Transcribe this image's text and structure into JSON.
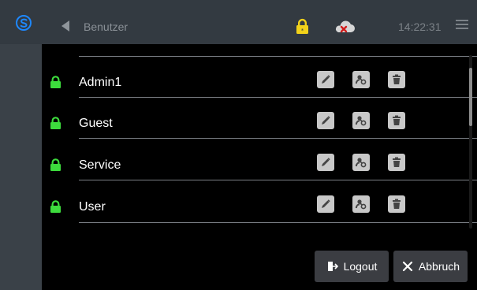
{
  "header": {
    "title": "Benutzer",
    "time": "14:22:31"
  },
  "users": [
    {
      "name": "Admin1"
    },
    {
      "name": "Guest"
    },
    {
      "name": "Service"
    },
    {
      "name": "User"
    }
  ],
  "footer": {
    "logout_label": "Logout",
    "cancel_label": "Abbruch"
  },
  "icons": {
    "logo": "logo-icon",
    "back": "back-arrow-icon",
    "status_lock": "lock-icon",
    "cloud": "cloud-disconnected-icon",
    "menu": "hamburger-menu-icon",
    "row_lock": "lock-icon",
    "edit": "pencil-icon",
    "permissions": "user-key-icon",
    "delete": "trash-icon",
    "logout": "logout-icon",
    "cancel": "close-icon"
  },
  "colors": {
    "sidebar": "#3a4148",
    "topbar": "#333a41",
    "accent_blue": "#1e88ff",
    "lock_yellow": "#f2d21a",
    "lock_green": "#3ddc3d",
    "cloud_error": "#d11b1b"
  }
}
